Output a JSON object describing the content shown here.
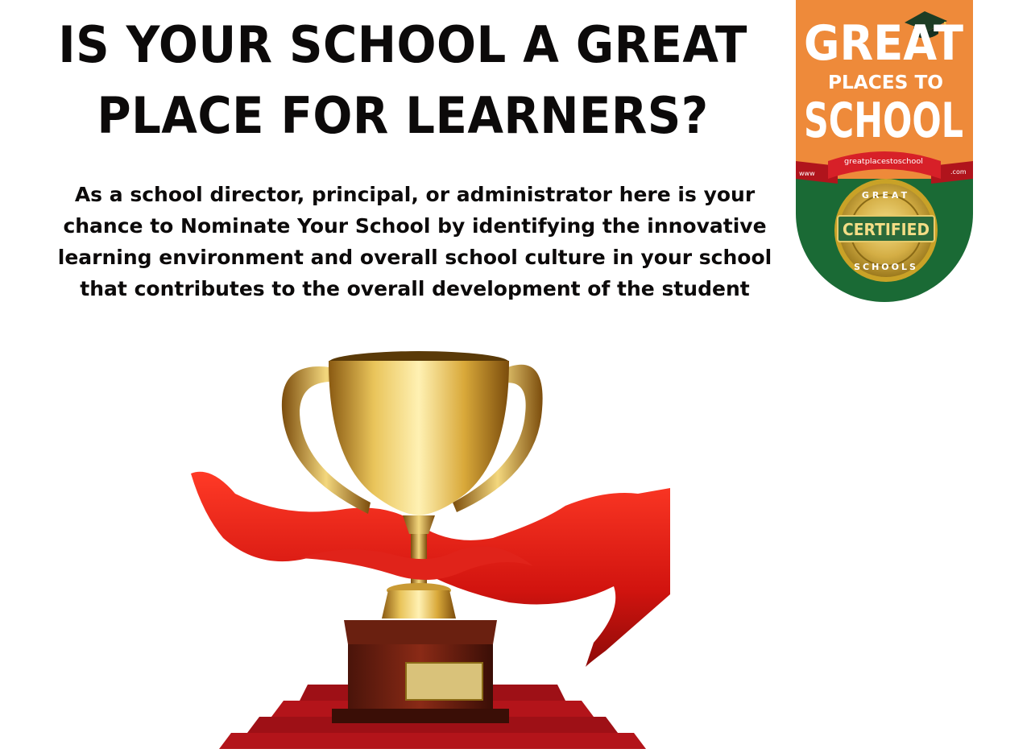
{
  "headline": {
    "line1": "IS YOUR SCHOOL A GREAT",
    "line2": "PLACE FOR LEARNERS?"
  },
  "body": {
    "lines": [
      "As a school director, principal, or administrator here is your",
      "chance to Nominate Your School by identifying the innovative",
      "learning environment and overall school culture in your school",
      "that contributes to the overall development of the student"
    ]
  },
  "badge": {
    "title_great": "GREAT",
    "title_places": "PLACES TO",
    "title_school": "SCHOOL",
    "ribbon_www": "www",
    "ribbon_site": "greatplacestoschool",
    "ribbon_com": ".com",
    "seal_top": "GREAT",
    "seal_center": "CERTIFIED",
    "seal_bottom": "SCHOOLS",
    "colors": {
      "orange": "#ee8a3a",
      "green": "#1a6a35",
      "red": "#c8202a",
      "gold": "#c9a227"
    }
  },
  "trophy": {
    "icon": "trophy-icon",
    "colors": {
      "gold": "#d8b040",
      "ribbon": "#d2140f",
      "base": "#7a2414",
      "carpet": "#b3141a"
    }
  }
}
